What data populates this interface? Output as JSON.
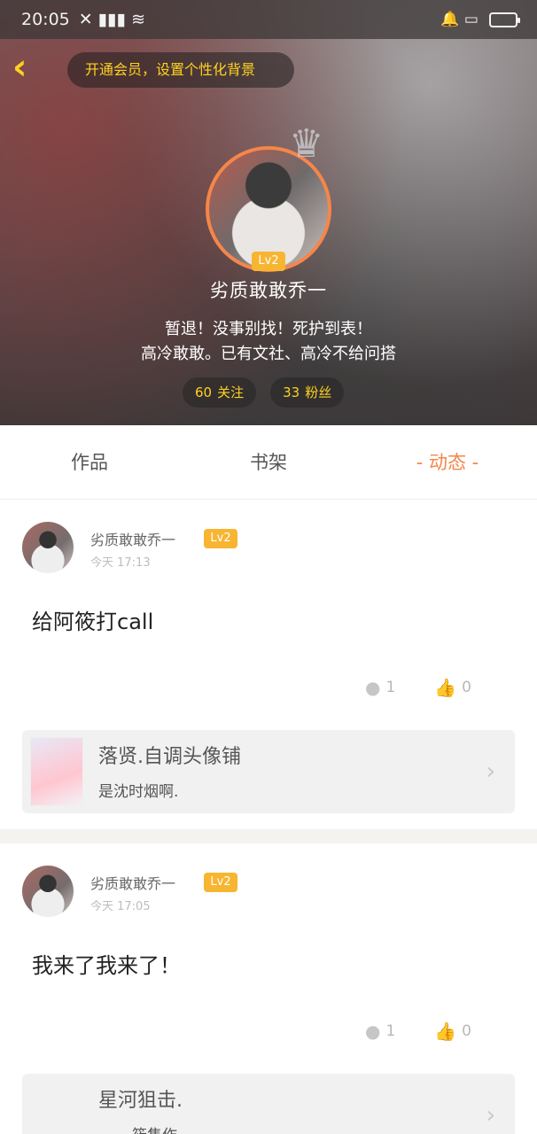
{
  "status_bar": {
    "time": "20:05",
    "network": "✕ ▮▮▮  ≋",
    "right_icons": "🔔  ▭"
  },
  "header": {
    "back_icon": "chevron-left-icon",
    "vip_prompt": "开通会员，设置个性化背景",
    "level": "Lv2",
    "username": "劣质敢敢乔一",
    "bio_line1": "暂退！没事别找！死护到表！",
    "bio_line2": "高冷敢敢。已有文社、高冷不给问搭",
    "following_count": "60",
    "following_label": "关注",
    "followers_count": "33",
    "followers_label": "粉丝"
  },
  "tabs": [
    {
      "label": "作品"
    },
    {
      "label": "书架"
    },
    {
      "label": "- 动态 -"
    }
  ],
  "posts": [
    {
      "author": "劣质敢敢乔一",
      "level": "Lv2",
      "time": "今天 17:13",
      "content": "给阿筱打call",
      "comments": "1",
      "likes": "0",
      "share_title": "落贤.自调头像铺",
      "share_sub": "是沈时烟啊."
    },
    {
      "author": "劣质敢敢乔一",
      "level": "Lv2",
      "time": "今天 17:05",
      "content": "我来了我来了！",
      "comments": "1",
      "likes": "0",
      "share_title": "星河狙击.",
      "share_sub": "筱隽作"
    }
  ],
  "colors": {
    "accent_orange": "#f5864a",
    "badge_yellow": "#f7b531",
    "prompt_yellow": "#ffd21f"
  }
}
